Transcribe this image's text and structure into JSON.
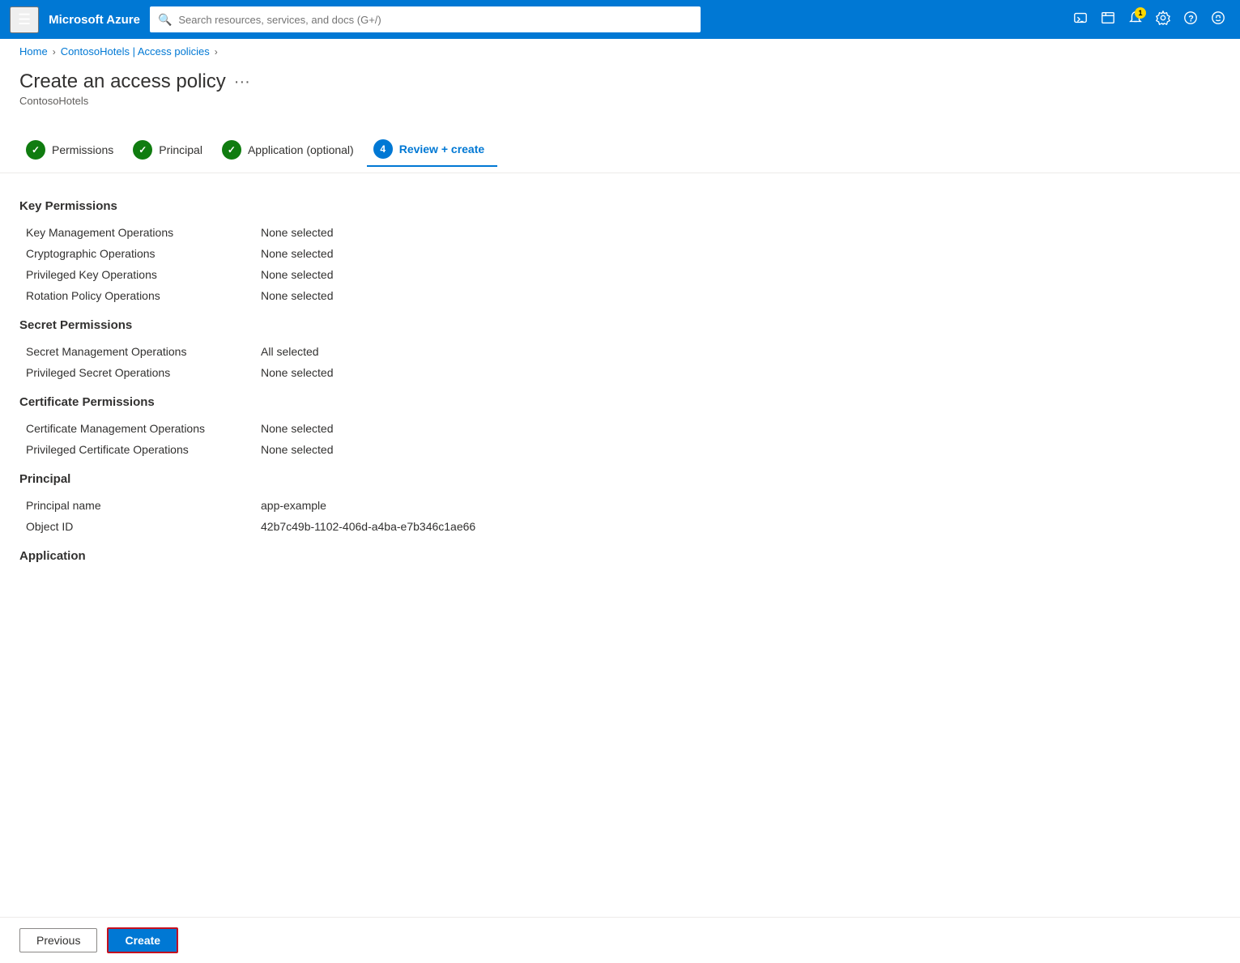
{
  "nav": {
    "hamburger_icon": "☰",
    "title": "Microsoft Azure",
    "search_placeholder": "Search resources, services, and docs (G+/)",
    "notification_count": "1"
  },
  "breadcrumb": {
    "home": "Home",
    "parent": "ContosoHotels | Access policies"
  },
  "page": {
    "title": "Create an access policy",
    "subtitle": "ContosoHotels",
    "ellipsis": "···"
  },
  "wizard": {
    "steps": [
      {
        "id": "permissions",
        "label": "Permissions",
        "status": "complete",
        "number": "1"
      },
      {
        "id": "principal",
        "label": "Principal",
        "status": "complete",
        "number": "2"
      },
      {
        "id": "application",
        "label": "Application (optional)",
        "status": "complete",
        "number": "3"
      },
      {
        "id": "review",
        "label": "Review + create",
        "status": "current",
        "number": "4"
      }
    ]
  },
  "sections": {
    "key_permissions": {
      "title": "Key Permissions",
      "rows": [
        {
          "label": "Key Management Operations",
          "value": "None selected"
        },
        {
          "label": "Cryptographic Operations",
          "value": "None selected"
        },
        {
          "label": "Privileged Key Operations",
          "value": "None selected"
        },
        {
          "label": "Rotation Policy Operations",
          "value": "None selected"
        }
      ]
    },
    "secret_permissions": {
      "title": "Secret Permissions",
      "rows": [
        {
          "label": "Secret Management Operations",
          "value": "All selected"
        },
        {
          "label": "Privileged Secret Operations",
          "value": "None selected"
        }
      ]
    },
    "certificate_permissions": {
      "title": "Certificate Permissions",
      "rows": [
        {
          "label": "Certificate Management Operations",
          "value": "None selected"
        },
        {
          "label": "Privileged Certificate Operations",
          "value": "None selected"
        }
      ]
    },
    "principal": {
      "title": "Principal",
      "rows": [
        {
          "label": "Principal name",
          "value": "app-example"
        },
        {
          "label": "Object ID",
          "value": "42b7c49b-1102-406d-a4ba-e7b346c1ae66"
        }
      ]
    },
    "application": {
      "title": "Application"
    }
  },
  "footer": {
    "previous_label": "Previous",
    "create_label": "Create"
  }
}
